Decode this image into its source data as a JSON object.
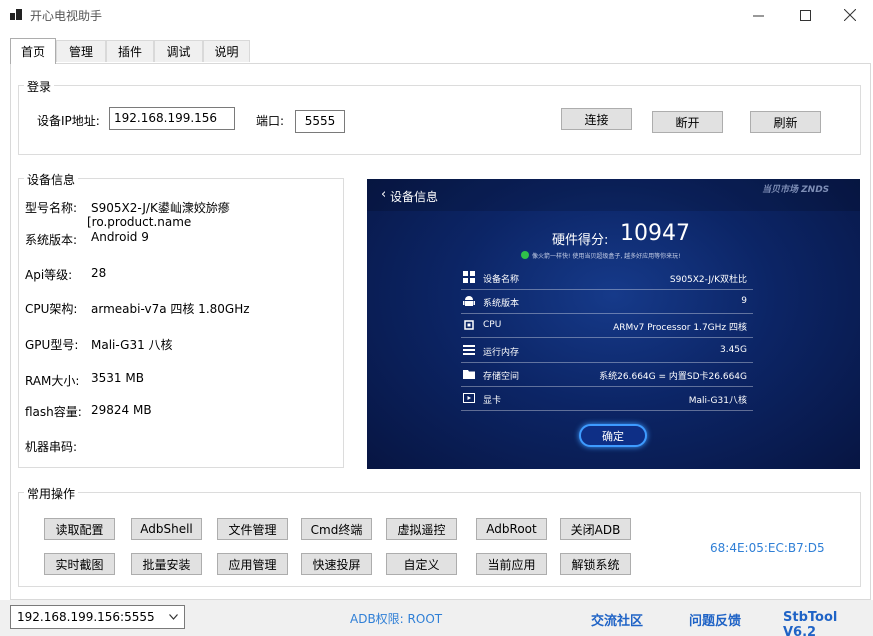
{
  "window": {
    "title": "开心电视助手"
  },
  "tabs": [
    "首页",
    "管理",
    "插件",
    "调试",
    "说明"
  ],
  "login": {
    "title": "登录",
    "ip_label": "设备IP地址:",
    "ip_value": "192.168.199.156",
    "port_label": "端口:",
    "port_value": "5555",
    "connect": "连接",
    "disconnect": "断开",
    "refresh": "刷新"
  },
  "device_info": {
    "title": "设备信息",
    "rows": [
      {
        "label": "型号名称:",
        "value": "S905X2-J/K鍙屾潨姣旀瘮"
      },
      {
        "label": "系统版本:",
        "value": "Android 9"
      },
      {
        "label": "Api等级:",
        "value": "28"
      },
      {
        "label": "CPU架构:",
        "value": "armeabi-v7a 四核 1.80GHz"
      },
      {
        "label": "GPU型号:",
        "value": "Mali-G31 八核"
      },
      {
        "label": "RAM大小:",
        "value": "3531 MB"
      },
      {
        "label": "flash容量:",
        "value": "29824 MB"
      },
      {
        "label": "机器串码:",
        "value": ""
      }
    ],
    "overlap_text": "[ro.product.name"
  },
  "tv_screen": {
    "header": "设备信息",
    "brand": "当贝市场 ZNDS",
    "score_label": "硬件得分:",
    "score_value": "10947",
    "notice": "像火箭一样快! 使用当贝超级盒子, 越多好应用等你来玩!",
    "rows": [
      {
        "icon": "grid-icon",
        "key": "设备名称",
        "value": "S905X2-J/K双杜比"
      },
      {
        "icon": "android-icon",
        "key": "系统版本",
        "value": "9"
      },
      {
        "icon": "cpu-icon",
        "key": "CPU",
        "value": "ARMv7 Processor 1.7GHz 四核"
      },
      {
        "icon": "memory-icon",
        "key": "运行内存",
        "value": "3.45G"
      },
      {
        "icon": "folder-icon",
        "key": "存储空间",
        "value": "系统26.664G = 内置SD卡26.664G"
      },
      {
        "icon": "display-icon",
        "key": "显卡",
        "value": "Mali-G31八核"
      }
    ],
    "ok_button": "确定"
  },
  "common_ops": {
    "title": "常用操作",
    "row1": [
      "读取配置",
      "AdbShell",
      "文件管理",
      "Cmd终端",
      "虚拟遥控",
      "AdbRoot",
      "关闭ADB"
    ],
    "row2": [
      "实时截图",
      "批量安装",
      "应用管理",
      "快速投屏",
      "自定义",
      "当前应用",
      "解锁系统"
    ],
    "mac": "68:4E:05:EC:B7:D5"
  },
  "status_bar": {
    "device_select": "192.168.199.156:5555",
    "adb_permission": "ADB权限:  ROOT",
    "community": "交流社区",
    "feedback": "问题反馈",
    "version": "StbTool V6.2"
  },
  "colors": {
    "link": "#1f63c6",
    "accent_blue": "#2f7fd6",
    "button_bg": "#e1e1e1"
  }
}
